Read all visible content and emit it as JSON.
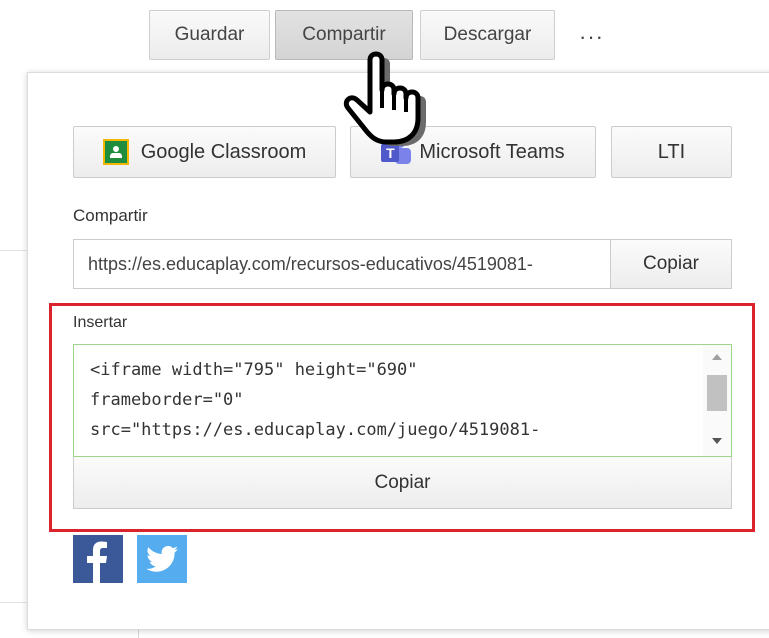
{
  "toolbar": {
    "buttons": [
      {
        "label": "Guardar"
      },
      {
        "label": "Compartir",
        "active": true
      },
      {
        "label": "Descargar"
      }
    ],
    "more_label": "···"
  },
  "panel": {
    "integrations": [
      {
        "label": "Google Classroom",
        "icon": "google-classroom-icon"
      },
      {
        "label": "Microsoft Teams",
        "icon": "microsoft-teams-icon"
      },
      {
        "label": "LTI"
      }
    ],
    "share": {
      "label": "Compartir",
      "url": "https://es.educaplay.com/recursos-educativos/4519081-",
      "copy_label": "Copiar"
    },
    "embed": {
      "label": "Insertar",
      "code": "<iframe width=\"795\" height=\"690\"\nframeborder=\"0\"\nsrc=\"https://es.educaplay.com/juego/4519081-",
      "copy_label": "Copiar"
    },
    "social": [
      {
        "icon": "facebook-icon",
        "color": "#3b5998"
      },
      {
        "icon": "twitter-icon",
        "color": "#55acee"
      }
    ]
  },
  "colors": {
    "highlight": "#d9232d",
    "embed_border": "#9fd58a"
  }
}
